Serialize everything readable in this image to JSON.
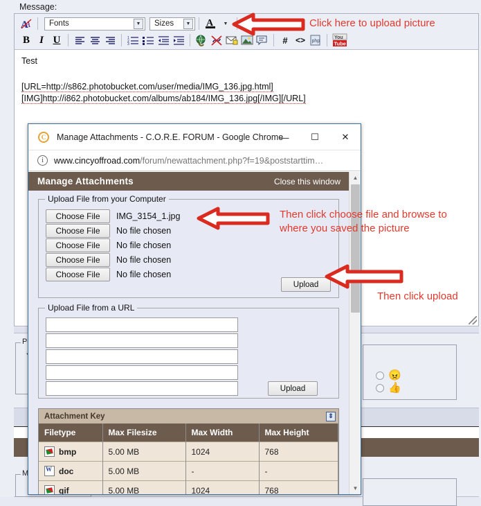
{
  "page": {
    "message_label": "Message:",
    "editor": {
      "toolbar_row1": [
        {
          "name": "remove-formatting-icon",
          "label": "A"
        },
        {
          "name": "font-select",
          "label": "Fonts"
        },
        {
          "name": "size-select",
          "label": "Sizes"
        },
        {
          "name": "font-color-icon",
          "label": "A"
        },
        {
          "name": "smilie-icon",
          "label": "☺"
        },
        {
          "name": "attachment-icon",
          "label": "0"
        }
      ],
      "font_select_value": "Fonts",
      "size_select_value": "Sizes",
      "toolbar_row2": [
        {
          "name": "bold-button",
          "label": "B"
        },
        {
          "name": "italic-button",
          "label": "I"
        },
        {
          "name": "underline-button",
          "label": "U"
        },
        {
          "name": "align-left-button",
          "label": "≡"
        },
        {
          "name": "align-center-button",
          "label": "≡"
        },
        {
          "name": "align-right-button",
          "label": "≡"
        },
        {
          "name": "ordered-list-button",
          "label": "1."
        },
        {
          "name": "unordered-list-button",
          "label": "•"
        },
        {
          "name": "outdent-button",
          "label": "⇤"
        },
        {
          "name": "indent-button",
          "label": "⇥"
        },
        {
          "name": "insert-link-button",
          "label": "🌐"
        },
        {
          "name": "remove-link-button",
          "label": "✖"
        },
        {
          "name": "insert-email-button",
          "label": "✉"
        },
        {
          "name": "insert-image-button",
          "label": "🖼"
        },
        {
          "name": "insert-quote-button",
          "label": "❝"
        },
        {
          "name": "insert-code-hash-button",
          "label": "#"
        },
        {
          "name": "insert-html-button",
          "label": "<>"
        },
        {
          "name": "insert-php-button",
          "label": "php"
        },
        {
          "name": "insert-video-button",
          "label": "You Tube"
        }
      ],
      "message_lines": [
        "Test",
        "",
        "[URL=http://s862.photobucket.com/user/media/IMG_136.jpg.html]",
        "[IMG]http://i862.photobucket.com/albums/ab184/IMG_136.jpg[/IMG][/URL]"
      ],
      "message_text_plain": "Test"
    },
    "background_fragments": {
      "post_icon_legend": "Po",
      "post_icon_sub": "Yo",
      "misc_legend": "Mi",
      "rating_emojis": [
        "😠",
        "👍"
      ]
    }
  },
  "chrome_window": {
    "favicon_letter": "C",
    "title": "Manage Attachments - C.O.R.E. FORUM - Google Chrome",
    "controls": {
      "minimize": "—",
      "maximize": "☐",
      "close": "✕"
    },
    "url_host": "www.cincyoffroad.com",
    "url_path": "/forum/newattachment.php?f=19&poststarttim…",
    "info_icon": "i"
  },
  "manage_attachments": {
    "header_title": "Manage Attachments",
    "close_link": "Close this window",
    "upload_from_computer": {
      "legend": "Upload File from your Computer",
      "rows": [
        {
          "button": "Choose File",
          "filename": "IMG_3154_1.jpg"
        },
        {
          "button": "Choose File",
          "filename": "No file chosen"
        },
        {
          "button": "Choose File",
          "filename": "No file chosen"
        },
        {
          "button": "Choose File",
          "filename": "No file chosen"
        },
        {
          "button": "Choose File",
          "filename": "No file chosen"
        }
      ],
      "upload_button": "Upload"
    },
    "upload_from_url": {
      "legend": "Upload File from a URL",
      "inputs": [
        "",
        "",
        "",
        "",
        ""
      ],
      "upload_button": "Upload"
    },
    "attachment_key": {
      "title": "Attachment Key",
      "collapse_icon": "collapse-icon",
      "columns": [
        "Filetype",
        "Max Filesize",
        "Max Width",
        "Max Height"
      ],
      "rows": [
        {
          "icon": "image-file-icon",
          "filetype": "bmp",
          "max_filesize": "5.00 MB",
          "max_width": "1024",
          "max_height": "768"
        },
        {
          "icon": "word-doc-icon",
          "filetype": "doc",
          "max_filesize": "5.00 MB",
          "max_width": "-",
          "max_height": "-"
        },
        {
          "icon": "image-file-icon",
          "filetype": "gif",
          "max_filesize": "5.00 MB",
          "max_width": "1024",
          "max_height": "768"
        }
      ]
    },
    "scrollbar": {
      "up": "▲",
      "down": "▼"
    }
  },
  "annotations": {
    "accent_color": "#e03a2e",
    "upload_picture": "Click here to upload picture",
    "choose_file": "Then click choose file and browse to\nwhere you saved the picture",
    "click_upload": "Then click upload"
  }
}
